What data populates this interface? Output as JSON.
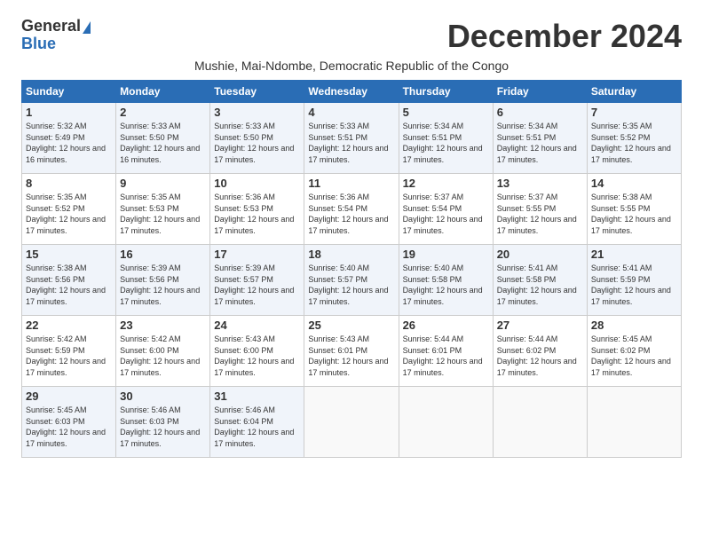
{
  "header": {
    "logo_general": "General",
    "logo_blue": "Blue",
    "month_title": "December 2024",
    "subtitle": "Mushie, Mai-Ndombe, Democratic Republic of the Congo"
  },
  "weekdays": [
    "Sunday",
    "Monday",
    "Tuesday",
    "Wednesday",
    "Thursday",
    "Friday",
    "Saturday"
  ],
  "weeks": [
    [
      {
        "day": "1",
        "sunrise": "5:32 AM",
        "sunset": "5:49 PM",
        "daylight": "12 hours and 16 minutes."
      },
      {
        "day": "2",
        "sunrise": "5:33 AM",
        "sunset": "5:50 PM",
        "daylight": "12 hours and 16 minutes."
      },
      {
        "day": "3",
        "sunrise": "5:33 AM",
        "sunset": "5:50 PM",
        "daylight": "12 hours and 17 minutes."
      },
      {
        "day": "4",
        "sunrise": "5:33 AM",
        "sunset": "5:51 PM",
        "daylight": "12 hours and 17 minutes."
      },
      {
        "day": "5",
        "sunrise": "5:34 AM",
        "sunset": "5:51 PM",
        "daylight": "12 hours and 17 minutes."
      },
      {
        "day": "6",
        "sunrise": "5:34 AM",
        "sunset": "5:51 PM",
        "daylight": "12 hours and 17 minutes."
      },
      {
        "day": "7",
        "sunrise": "5:35 AM",
        "sunset": "5:52 PM",
        "daylight": "12 hours and 17 minutes."
      }
    ],
    [
      {
        "day": "8",
        "sunrise": "5:35 AM",
        "sunset": "5:52 PM",
        "daylight": "12 hours and 17 minutes."
      },
      {
        "day": "9",
        "sunrise": "5:35 AM",
        "sunset": "5:53 PM",
        "daylight": "12 hours and 17 minutes."
      },
      {
        "day": "10",
        "sunrise": "5:36 AM",
        "sunset": "5:53 PM",
        "daylight": "12 hours and 17 minutes."
      },
      {
        "day": "11",
        "sunrise": "5:36 AM",
        "sunset": "5:54 PM",
        "daylight": "12 hours and 17 minutes."
      },
      {
        "day": "12",
        "sunrise": "5:37 AM",
        "sunset": "5:54 PM",
        "daylight": "12 hours and 17 minutes."
      },
      {
        "day": "13",
        "sunrise": "5:37 AM",
        "sunset": "5:55 PM",
        "daylight": "12 hours and 17 minutes."
      },
      {
        "day": "14",
        "sunrise": "5:38 AM",
        "sunset": "5:55 PM",
        "daylight": "12 hours and 17 minutes."
      }
    ],
    [
      {
        "day": "15",
        "sunrise": "5:38 AM",
        "sunset": "5:56 PM",
        "daylight": "12 hours and 17 minutes."
      },
      {
        "day": "16",
        "sunrise": "5:39 AM",
        "sunset": "5:56 PM",
        "daylight": "12 hours and 17 minutes."
      },
      {
        "day": "17",
        "sunrise": "5:39 AM",
        "sunset": "5:57 PM",
        "daylight": "12 hours and 17 minutes."
      },
      {
        "day": "18",
        "sunrise": "5:40 AM",
        "sunset": "5:57 PM",
        "daylight": "12 hours and 17 minutes."
      },
      {
        "day": "19",
        "sunrise": "5:40 AM",
        "sunset": "5:58 PM",
        "daylight": "12 hours and 17 minutes."
      },
      {
        "day": "20",
        "sunrise": "5:41 AM",
        "sunset": "5:58 PM",
        "daylight": "12 hours and 17 minutes."
      },
      {
        "day": "21",
        "sunrise": "5:41 AM",
        "sunset": "5:59 PM",
        "daylight": "12 hours and 17 minutes."
      }
    ],
    [
      {
        "day": "22",
        "sunrise": "5:42 AM",
        "sunset": "5:59 PM",
        "daylight": "12 hours and 17 minutes."
      },
      {
        "day": "23",
        "sunrise": "5:42 AM",
        "sunset": "6:00 PM",
        "daylight": "12 hours and 17 minutes."
      },
      {
        "day": "24",
        "sunrise": "5:43 AM",
        "sunset": "6:00 PM",
        "daylight": "12 hours and 17 minutes."
      },
      {
        "day": "25",
        "sunrise": "5:43 AM",
        "sunset": "6:01 PM",
        "daylight": "12 hours and 17 minutes."
      },
      {
        "day": "26",
        "sunrise": "5:44 AM",
        "sunset": "6:01 PM",
        "daylight": "12 hours and 17 minutes."
      },
      {
        "day": "27",
        "sunrise": "5:44 AM",
        "sunset": "6:02 PM",
        "daylight": "12 hours and 17 minutes."
      },
      {
        "day": "28",
        "sunrise": "5:45 AM",
        "sunset": "6:02 PM",
        "daylight": "12 hours and 17 minutes."
      }
    ],
    [
      {
        "day": "29",
        "sunrise": "5:45 AM",
        "sunset": "6:03 PM",
        "daylight": "12 hours and 17 minutes."
      },
      {
        "day": "30",
        "sunrise": "5:46 AM",
        "sunset": "6:03 PM",
        "daylight": "12 hours and 17 minutes."
      },
      {
        "day": "31",
        "sunrise": "5:46 AM",
        "sunset": "6:04 PM",
        "daylight": "12 hours and 17 minutes."
      },
      null,
      null,
      null,
      null
    ]
  ],
  "labels": {
    "sunrise": "Sunrise: ",
    "sunset": "Sunset: ",
    "daylight": "Daylight: "
  }
}
